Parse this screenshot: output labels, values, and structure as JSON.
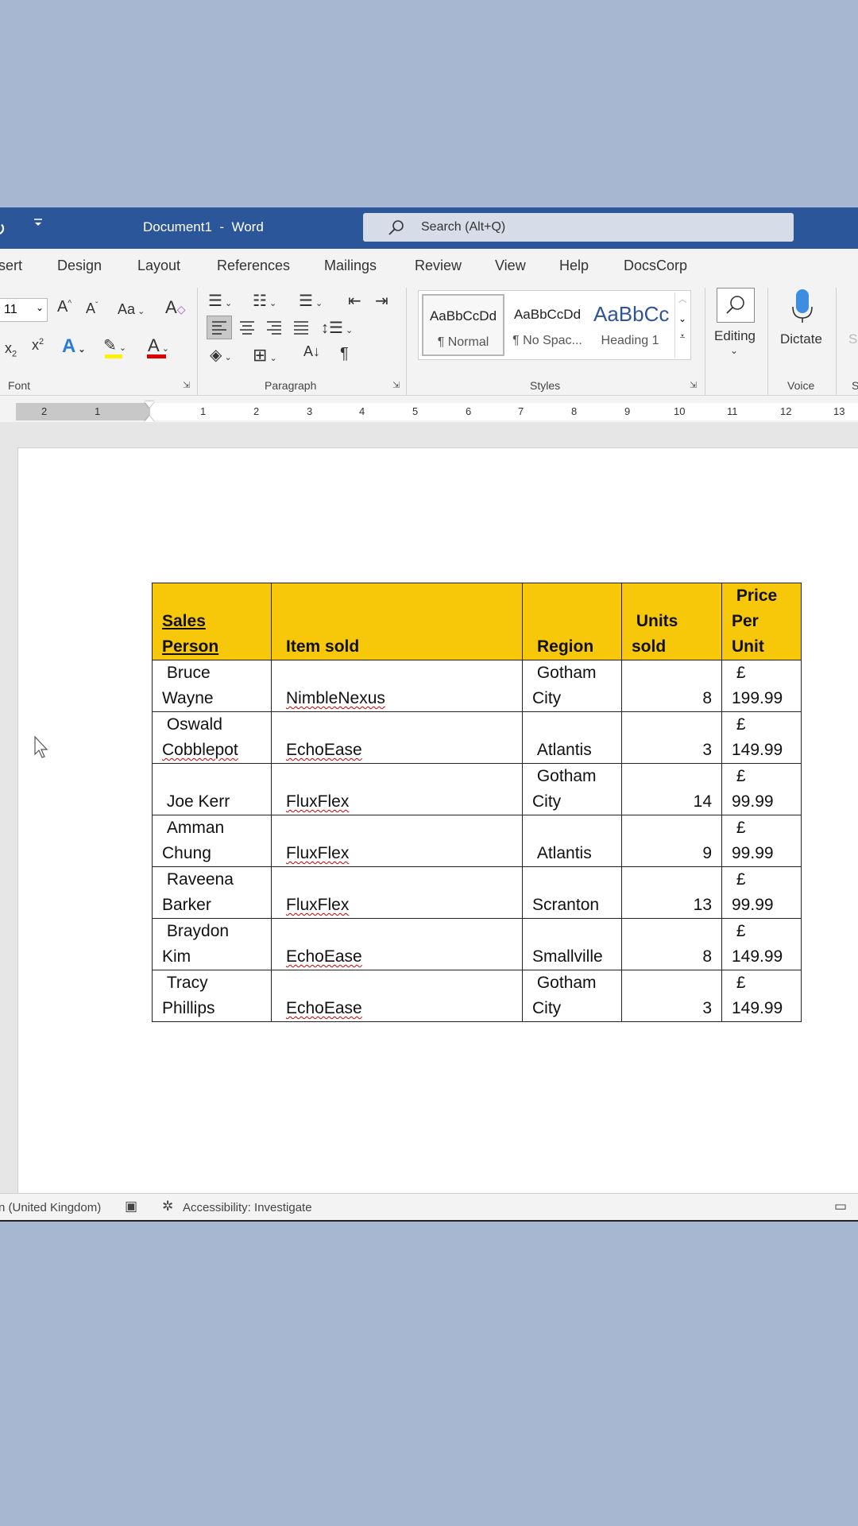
{
  "titlebar": {
    "doc_title": "Document1  -  Word",
    "search_placeholder": "Search (Alt+Q)"
  },
  "tabs": [
    "sert",
    "Design",
    "Layout",
    "References",
    "Mailings",
    "Review",
    "View",
    "Help",
    "DocsCorp"
  ],
  "ribbon": {
    "font_size": "11",
    "groups": {
      "font": "Font",
      "paragraph": "Paragraph",
      "styles": "Styles",
      "voice": "Voice"
    },
    "styles": [
      {
        "preview": "AaBbCcDd",
        "name": "¶ Normal"
      },
      {
        "preview": "AaBbCcDd",
        "name": "¶ No Spac..."
      },
      {
        "preview": "AaBbCc",
        "name": "Heading 1"
      }
    ],
    "editing_label": "Editing",
    "dictate_label": "Dictate",
    "change_case": "Aa"
  },
  "ruler": {
    "left_numbers": [
      "2",
      "1"
    ],
    "numbers": [
      "1",
      "2",
      "3",
      "4",
      "5",
      "6",
      "7",
      "8",
      "9",
      "10",
      "11",
      "12",
      "13"
    ]
  },
  "table": {
    "headers": {
      "salesperson": [
        "Sales",
        "Person"
      ],
      "item": "Item sold",
      "region": "Region",
      "units": [
        "Units",
        "sold"
      ],
      "price": [
        "Price",
        "Per",
        "Unit"
      ]
    },
    "rows": [
      {
        "name1": "Bruce",
        "name2": "Wayne",
        "item": "NimbleNexus",
        "region1": "Gotham",
        "region2": "City",
        "units": "8",
        "cur": "£",
        "price": "199.99"
      },
      {
        "name1": "Oswald",
        "name2": "Cobblepot",
        "item": "EchoEase",
        "region1": "",
        "region2": "Atlantis",
        "units": "3",
        "cur": "£",
        "price": "149.99"
      },
      {
        "name1": "",
        "name2": "Joe Kerr",
        "item": "FluxFlex",
        "region1": "Gotham",
        "region2": "City",
        "units": "14",
        "cur": "£",
        "price": "99.99"
      },
      {
        "name1": "Amman",
        "name2": "Chung",
        "item": "FluxFlex",
        "region1": "",
        "region2": "Atlantis",
        "units": "9",
        "cur": "£",
        "price": "99.99"
      },
      {
        "name1": "Raveena",
        "name2": "Barker",
        "item": "FluxFlex",
        "region1": "",
        "region2": "Scranton",
        "units": "13",
        "cur": "£",
        "price": "99.99"
      },
      {
        "name1": "Braydon",
        "name2": "Kim",
        "item": "EchoEase",
        "region1": "",
        "region2": "Smallville",
        "units": "8",
        "cur": "£",
        "price": "149.99"
      },
      {
        "name1": "Tracy",
        "name2": "Phillips",
        "item": "EchoEase",
        "region1": "Gotham",
        "region2": "City",
        "units": "3",
        "cur": "£",
        "price": "149.99"
      }
    ]
  },
  "status": {
    "language": "n (United Kingdom)",
    "accessibility": "Accessibility: Investigate"
  },
  "colors": {
    "titlebar": "#2b579a",
    "header_fill": "#f7c70a",
    "background": "#a8b7d1"
  }
}
